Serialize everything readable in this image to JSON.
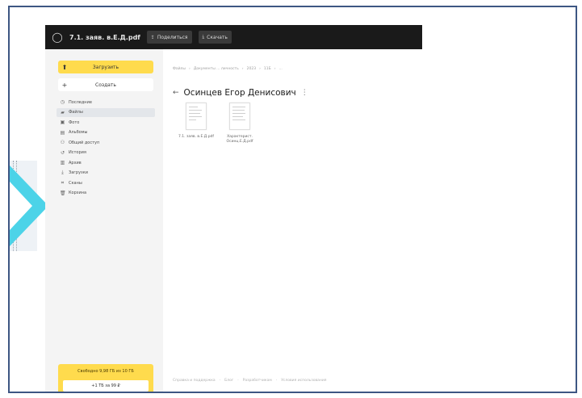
{
  "topbar": {
    "filename": "7.1. заяв. в.Е.Д.pdf",
    "buttons": [
      {
        "label": "Поделиться",
        "icon": "share-icon"
      },
      {
        "label": "Скачать",
        "icon": "download-icon"
      }
    ]
  },
  "sidebar": {
    "upload_label": "Загрузить",
    "create_label": "Создать",
    "items": [
      {
        "label": "Последние",
        "icon": "clock-icon"
      },
      {
        "label": "Файлы",
        "icon": "folder-icon",
        "active": true
      },
      {
        "label": "Фото",
        "icon": "photo-icon"
      },
      {
        "label": "Альбомы",
        "icon": "album-icon"
      },
      {
        "label": "Общий доступ",
        "icon": "shared-icon"
      },
      {
        "label": "История",
        "icon": "history-icon"
      },
      {
        "label": "Архив",
        "icon": "archive-icon"
      },
      {
        "label": "Загрузки",
        "icon": "download-icon"
      },
      {
        "label": "Сканы",
        "icon": "scan-icon"
      },
      {
        "label": "Корзина",
        "icon": "trash-icon"
      }
    ],
    "storage_text": "Свободно 9,98 ГБ из 10 ГБ",
    "storage_button": "+1 ТБ за 99 ₽"
  },
  "main": {
    "breadcrumbs": [
      "Файлы",
      "›",
      "Документы ... личность",
      "›",
      "2023",
      "›",
      "11Б",
      "›",
      "..."
    ],
    "title": "Осинцев Егор Денисович",
    "files": [
      {
        "name": "7.1. заяв. в.Е.Д.pdf"
      },
      {
        "name": "Характерист. Осинц.Е.Д.pdf"
      }
    ],
    "footer": [
      "Справка и поддержка",
      "·",
      "Блог",
      "·",
      "Разработчикам",
      "·",
      "Условия использования"
    ]
  },
  "colors": {
    "accent": "#ffdb4d",
    "topbar": "#1a1a1a",
    "frame_border": "#3d5683",
    "deco_arrow": "#4cd3e8"
  }
}
